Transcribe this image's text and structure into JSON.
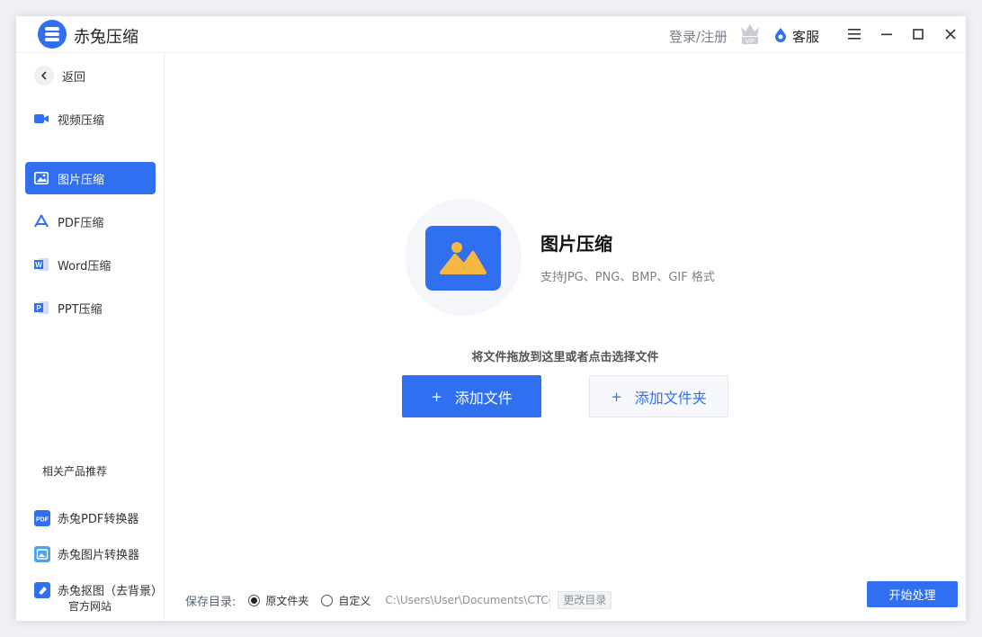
{
  "app": {
    "title": "赤兔压缩"
  },
  "header": {
    "login_label": "登录/注册",
    "vip_icon": "vip-crown-icon",
    "service_label": "客服"
  },
  "sidebar": {
    "back_label": "返回",
    "items": [
      {
        "label": "视频压缩",
        "icon": "video-icon",
        "active": false
      },
      {
        "label": "图片压缩",
        "icon": "image-icon",
        "active": true
      },
      {
        "label": "PDF压缩",
        "icon": "pdf-icon",
        "active": false
      },
      {
        "label": "Word压缩",
        "icon": "word-icon",
        "active": false
      },
      {
        "label": "PPT压缩",
        "icon": "ppt-icon",
        "active": false
      }
    ],
    "recommend_title": "相关产品推荐",
    "recommend": [
      {
        "label": "赤兔PDF转换器",
        "icon": "pdf-converter-icon"
      },
      {
        "label": "赤兔图片转换器",
        "icon": "image-converter-icon"
      },
      {
        "label": "赤兔抠图（去背景）",
        "icon": "eraser-icon"
      }
    ],
    "official_site": "官方网站"
  },
  "main": {
    "title": "图片压缩",
    "subtitle": "支持JPG、PNG、BMP、GIF 格式",
    "hint": "将文件拖放到这里或者点击选择文件",
    "add_file_label": "添加文件",
    "add_folder_label": "添加文件夹",
    "plus_symbol": "+"
  },
  "footer": {
    "save_label": "保存目录:",
    "option_original": "原文件夹",
    "option_custom": "自定义",
    "selected_option": "原文件夹",
    "path": "C:\\Users\\User\\Documents\\CTCompress",
    "change_label": "更改目录",
    "start_label": "开始处理"
  },
  "colors": {
    "accent": "#2f6ff0",
    "hero_bg": "#f4f6fa",
    "warm": "#f5b942"
  }
}
